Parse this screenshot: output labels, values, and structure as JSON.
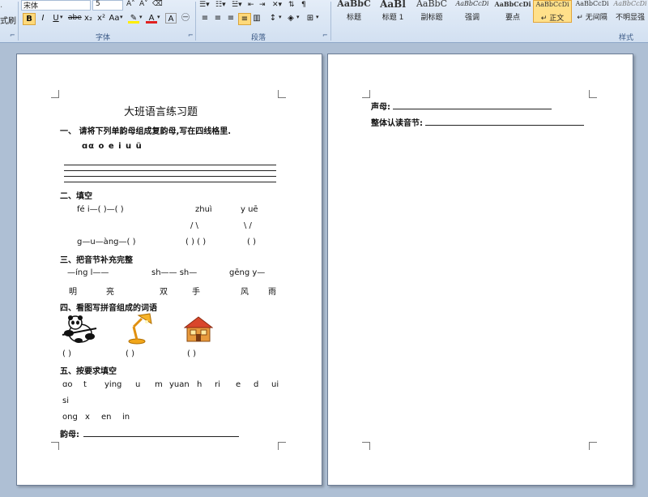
{
  "ribbon": {
    "left_cut_1": "式刷",
    "font_group_label": "字体",
    "paragraph_group_label": "段落",
    "styles_group_label": "样式",
    "font_name": "宋体",
    "font_size": "5",
    "bold": "B",
    "italic": "I",
    "underline": "U",
    "strike": "abe",
    "subscript": "x₂",
    "superscript": "x²",
    "change_case": "Aa",
    "font_color": "A",
    "char_border": "A",
    "enclose": "㊀",
    "styles": [
      {
        "sample": "AaBbC",
        "name": "标题"
      },
      {
        "sample": "AaBl",
        "name": "标题 1"
      },
      {
        "sample": "AaBbC",
        "name": "副标题"
      },
      {
        "sample": "AaBbCcDi",
        "name": "强调"
      },
      {
        "sample": "AaBbCcDi",
        "name": "要点"
      },
      {
        "sample": "AaBbCcDi",
        "name": "↵ 正文"
      },
      {
        "sample": "AaBbCcDi",
        "name": "↵ 无间隔"
      },
      {
        "sample": "AaBbCcDi",
        "name": "不明显强调"
      }
    ]
  },
  "page1": {
    "title": "大班语言练习题",
    "q1": "一、 请将下列单韵母组成复韵母,写在四线格里.",
    "q1_letters": "ɑα   o   e   i   u   ü",
    "q2": "二、填空",
    "q2_line1a": "fé  i—(  )—(  )",
    "q2_line1b": "zhuì",
    "q2_line1c": "y   uē",
    "q2_line2a": "/ \\",
    "q2_line2b": "\\   /",
    "q2_line3a": "g—u—àng—(      )",
    "q2_line3b": "(  ) (  )",
    "q2_line3c": "(     )",
    "q3": "三、把音节补充完整",
    "q3_line1a": "—íng  l——",
    "q3_line1b": "sh——  sh—",
    "q3_line1c": "gēng  y—",
    "q3_words": [
      "明",
      "亮",
      "双",
      "手",
      "风",
      "雨"
    ],
    "q4": "四、看图写拼音组成的词语",
    "q4_blank1": "(      )",
    "q4_blank2": "(       )",
    "q4_blank3": "(        )",
    "q5": "五、按要求填空",
    "q5_row1": [
      "ɑo",
      "t",
      "ying",
      "u",
      "m",
      "yuan",
      "h",
      "ri",
      "e",
      "d",
      "ui"
    ],
    "q5_row2": "si",
    "q5_row3": [
      "ong",
      "x",
      "en",
      "in"
    ],
    "q5_answer_label": "韵母:"
  },
  "page2": {
    "line1_label": "声母:",
    "line2_label": "整体认读音节:"
  }
}
